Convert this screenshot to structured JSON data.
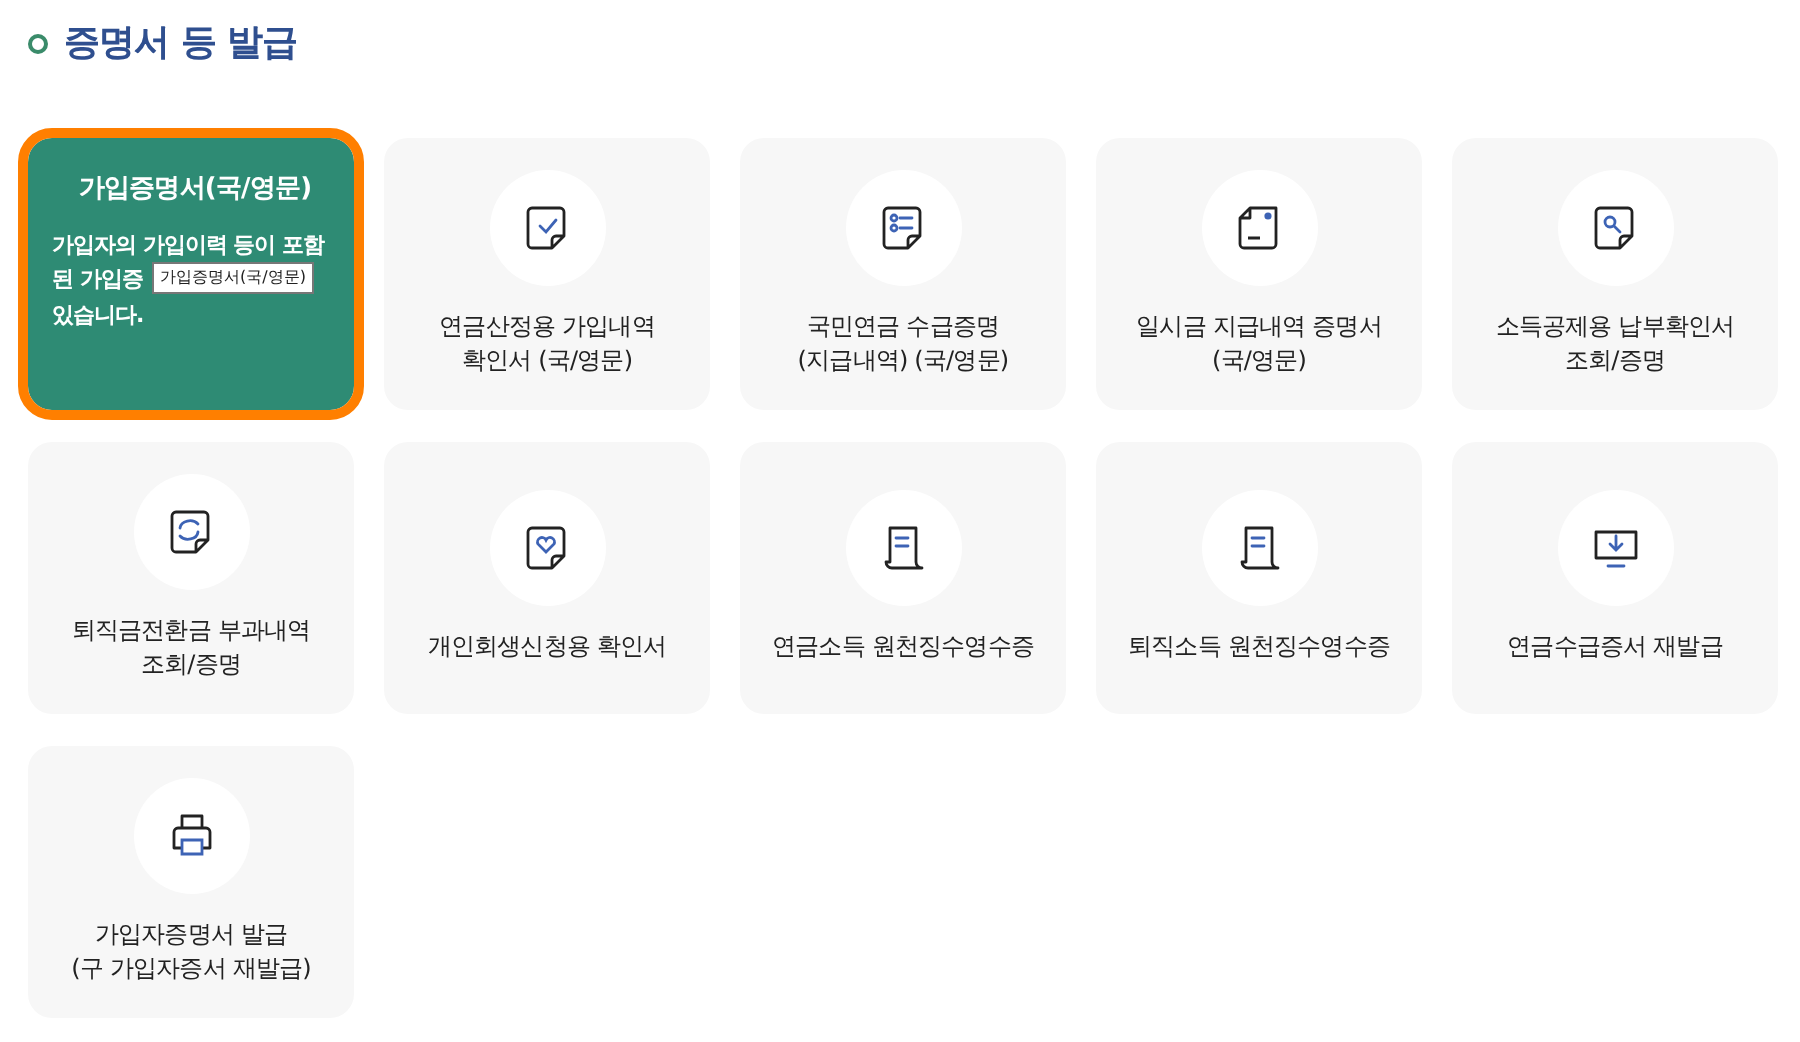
{
  "section_title": "증명서 등 발급",
  "items": [
    {
      "label": "가입증명서(국/영문)",
      "selected": true,
      "description": [
        "가입자의 가입이력 등이 포함",
        "된 가입증",
        "있습니다."
      ],
      "tooltip": "가입증명서(국/영문)"
    },
    {
      "label": "연금산정용 가입내역\n확인서 (국/영문)",
      "selected": false
    },
    {
      "label": "국민연금 수급증명\n(지급내역) (국/영문)",
      "selected": false
    },
    {
      "label": "일시금 지급내역 증명서\n(국/영문)",
      "selected": false
    },
    {
      "label": "소득공제용 납부확인서\n조회/증명",
      "selected": false
    },
    {
      "label": "퇴직금전환금 부과내역\n조회/증명",
      "selected": false
    },
    {
      "label": "개인회생신청용 확인서",
      "selected": false
    },
    {
      "label": "연금소득 원천징수영수증",
      "selected": false
    },
    {
      "label": "퇴직소득 원천징수영수증",
      "selected": false
    },
    {
      "label": "연금수급증서 재발급",
      "selected": false
    },
    {
      "label": "가입자증명서 발급\n(구 가입자증서 재발급)",
      "selected": false
    }
  ]
}
